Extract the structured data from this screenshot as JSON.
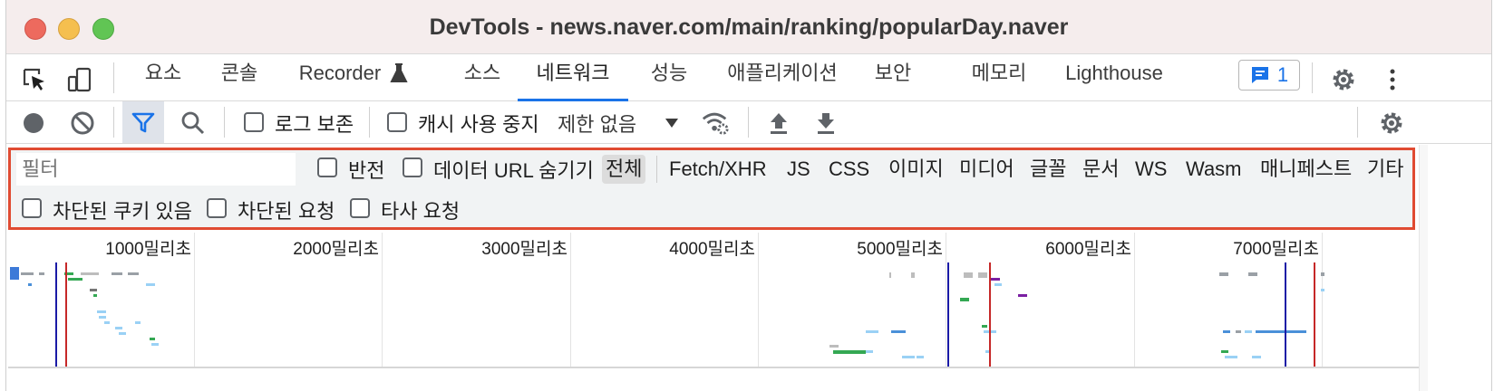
{
  "window": {
    "title": "DevTools - news.naver.com/main/ranking/popularDay.naver"
  },
  "tabs": [
    {
      "label": "요소"
    },
    {
      "label": "콘솔"
    },
    {
      "label": "Recorder"
    },
    {
      "label": "소스"
    },
    {
      "label": "네트워크"
    },
    {
      "label": "성능"
    },
    {
      "label": "애플리케이션"
    },
    {
      "label": "보안"
    },
    {
      "label": "메모리"
    },
    {
      "label": "Lighthouse"
    }
  ],
  "active_tab": "네트워크",
  "issues_badge": {
    "count": "1"
  },
  "toolbar": {
    "preserve_log": "로그 보존",
    "disable_cache": "캐시 사용 중지",
    "throttling": "제한 없음"
  },
  "filter": {
    "placeholder": "필터",
    "invert": "반전",
    "hide_data_urls": "데이터 URL 숨기기",
    "types": [
      "전체",
      "Fetch/XHR",
      "JS",
      "CSS",
      "이미지",
      "미디어",
      "글꼴",
      "문서",
      "WS",
      "Wasm",
      "매니페스트",
      "기타"
    ],
    "active_type": "전체",
    "blocked_cookies": "차단된 쿠키 있음",
    "blocked_requests": "차단된 요청",
    "third_party": "타사 요청"
  },
  "timeline": {
    "ticks": [
      "1000밀리초",
      "2000밀리초",
      "3000밀리초",
      "4000밀리초",
      "5000밀리초",
      "6000밀리초",
      "7000밀리초"
    ]
  },
  "colors": {
    "accent": "#1a73e8",
    "highlight_border": "#e04b32",
    "dom_content_loaded": "#1a1aa6",
    "load": "#c62828"
  }
}
